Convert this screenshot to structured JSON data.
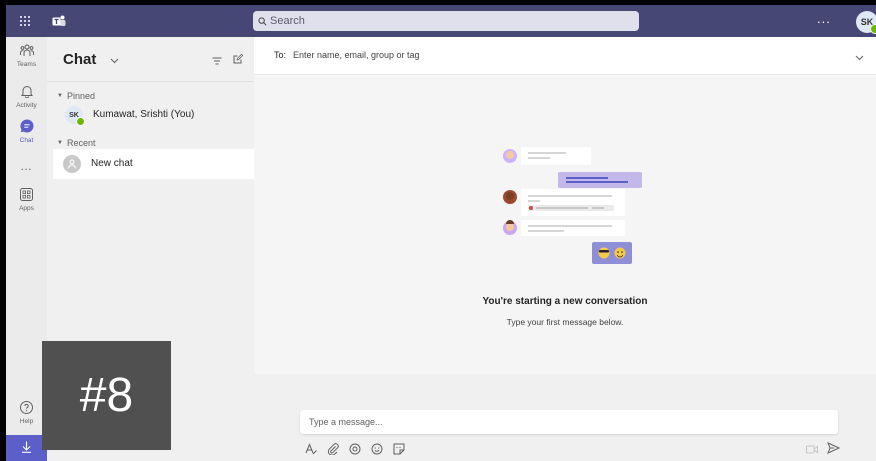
{
  "topbar": {
    "search_placeholder": "Search",
    "more_label": "...",
    "avatar_initials": "SK"
  },
  "rail": {
    "items": [
      {
        "label": "Teams",
        "icon": "teams-icon"
      },
      {
        "label": "Activity",
        "icon": "bell-icon"
      },
      {
        "label": "Chat",
        "icon": "chat-icon",
        "active": true
      },
      {
        "label": "Apps",
        "icon": "apps-icon"
      },
      {
        "label": "Help",
        "icon": "help-icon"
      }
    ],
    "more_label": "…"
  },
  "chat_list": {
    "title": "Chat",
    "pinned_label": "Pinned",
    "recent_label": "Recent",
    "pinned_items": [
      {
        "initials": "SK",
        "name": "Kumawat, Srishti (You)"
      }
    ],
    "recent_items": [
      {
        "name": "New chat"
      }
    ]
  },
  "main": {
    "to_label": "To:",
    "to_placeholder": "Enter name, email, group or tag",
    "empty_title": "You're starting a new conversation",
    "empty_subtitle": "Type your first message below.",
    "compose_placeholder": "Type a message..."
  },
  "overlay": {
    "label": "#8"
  },
  "colors": {
    "topbar": "#464775",
    "accent": "#5b5fc7",
    "presence": "#6bb700"
  }
}
